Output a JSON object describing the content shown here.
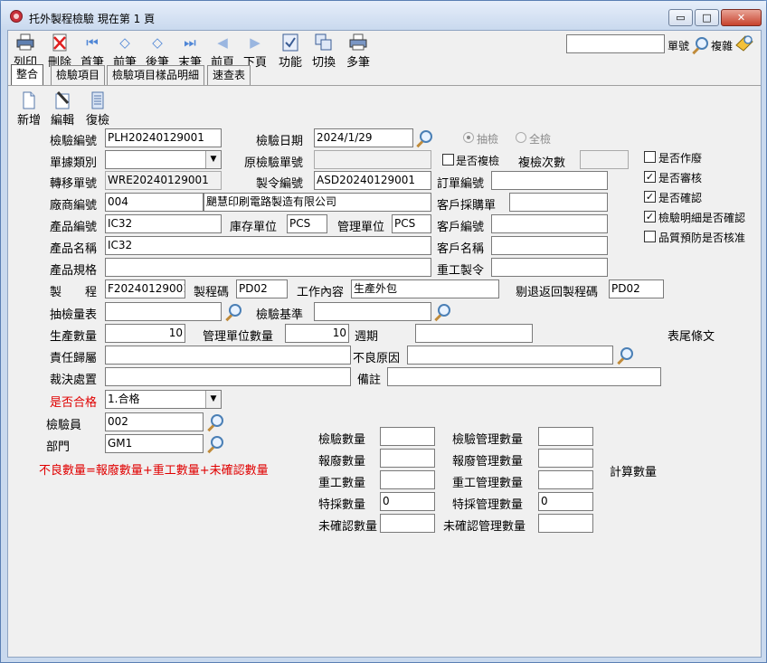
{
  "window": {
    "title": "托外製程檢驗 現在第 1 頁",
    "minimize": "▭",
    "maximize": "□",
    "close": "✕"
  },
  "toolbar": {
    "buttons": [
      {
        "label": "列印",
        "icon": "printer-icon"
      },
      {
        "label": "刪除",
        "icon": "delete-icon"
      },
      {
        "label": "首筆",
        "icon": "first-record-icon"
      },
      {
        "label": "前筆",
        "icon": "prev-record-icon"
      },
      {
        "label": "後筆",
        "icon": "next-record-icon"
      },
      {
        "label": "末筆",
        "icon": "last-record-icon"
      },
      {
        "label": "前頁",
        "icon": "prev-page-icon"
      },
      {
        "label": "下頁",
        "icon": "next-page-icon"
      },
      {
        "label": "功能",
        "icon": "function-icon"
      },
      {
        "label": "切換",
        "icon": "switch-icon"
      },
      {
        "label": "多筆",
        "icon": "multi-record-icon"
      }
    ],
    "search_value": "",
    "doc_no_label": "單號",
    "complex_label": "複雜"
  },
  "tabs": [
    "整合",
    "檢驗項目",
    "檢驗項目樣品明細",
    "速查表"
  ],
  "subtoolbar": {
    "new": "新增",
    "edit": "編輯",
    "copy": "復檢"
  },
  "form": {
    "inspect_no_label": "檢驗編號",
    "inspect_no": "PLH20240129001",
    "inspect_date_label": "檢驗日期",
    "inspect_date": "2024/1/29",
    "radio_sample": "抽檢",
    "radio_full": "全檢",
    "doc_type_label": "單據類別",
    "doc_type": "",
    "orig_inspect_label": "原檢驗單號",
    "orig_inspect": "",
    "is_reinspect": "是否複檢",
    "reinspect_count_label": "複檢次數",
    "reinspect_count": "",
    "transfer_no_label": "轉移單號",
    "transfer_no": "WRE20240129001",
    "mo_no_label": "製令編號",
    "mo_no": "ASD20240129001",
    "order_no_label": "訂單編號",
    "order_no": "",
    "vendor_no_label": "廠商編號",
    "vendor_no": "004",
    "vendor_name": "颶慧印刷電路製造有限公司",
    "cust_po_label": "客戶採購單",
    "cust_po": "",
    "product_no_label": "產品編號",
    "product_no": "IC32",
    "stock_unit_label": "庫存單位",
    "stock_unit": "PCS",
    "mgmt_unit_label": "管理單位",
    "mgmt_unit": "PCS",
    "cust_no_label": "客戶編號",
    "cust_no": "",
    "product_name_label": "產品名稱",
    "product_name": "IC32",
    "cust_name_label": "客戶名稱",
    "cust_name": "",
    "product_spec_label": "產品規格",
    "product_spec": "",
    "rework_mo_label": "重工製令",
    "rework_mo": "",
    "process_label": "製　　程",
    "process": "F20240129001",
    "process_code_label": "製程碼",
    "process_code": "PD02",
    "work_content_label": "工作內容",
    "work_content": "生產外包",
    "reject_return_label": "剔退返回製程碼",
    "reject_return": "PD02",
    "sample_table_label": "抽檢量表",
    "sample_table": "",
    "inspect_std_label": "檢驗基準",
    "inspect_std": "",
    "prod_qty_label": "生產數量",
    "prod_qty": "10",
    "mgmt_qty_label": "管理單位數量",
    "mgmt_qty": "10",
    "cycle_label": "週期",
    "cycle": "",
    "footer_text_label": "表尾條文",
    "responsibility_label": "責任歸屬",
    "responsibility": "",
    "defect_reason_label": "不良原因",
    "defect_reason": "",
    "decision_label": "裁決處置",
    "decision": "",
    "remark_label": "備註",
    "remark": "",
    "pass_label": "是否合格",
    "pass": "1.合格",
    "inspector_label": "檢驗員",
    "inspector": "002",
    "dept_label": "部門",
    "dept": "GM1",
    "defect_formula": "不良數量=報廢數量+重工數量+未確認數量"
  },
  "checkboxes": [
    {
      "label": "是否作廢",
      "checked": false
    },
    {
      "label": "是否審核",
      "checked": true
    },
    {
      "label": "是否確認",
      "checked": true
    },
    {
      "label": "檢驗明細是否確認",
      "checked": true
    },
    {
      "label": "品質預防是否核准",
      "checked": false
    }
  ],
  "quantities": {
    "inspect_qty_label": "檢驗數量",
    "inspect_qty": "",
    "scrap_qty_label": "報廢數量",
    "scrap_qty": "",
    "rework_qty_label": "重工數量",
    "rework_qty": "",
    "special_qty_label": "特採數量",
    "special_qty": "0",
    "unconfirmed_qty_label": "未確認數量",
    "unconfirmed_qty": "",
    "inspect_mgmt_qty_label": "檢驗管理數量",
    "inspect_mgmt_qty": "",
    "scrap_mgmt_qty_label": "報廢管理數量",
    "scrap_mgmt_qty": "",
    "rework_mgmt_qty_label": "重工管理數量",
    "rework_mgmt_qty": "",
    "special_mgmt_qty_label": "特採管理數量",
    "special_mgmt_qty": "0",
    "unconfirmed_mgmt_qty_label": "未確認管理數量",
    "unconfirmed_mgmt_qty": "",
    "calc_label": "計算數量"
  }
}
